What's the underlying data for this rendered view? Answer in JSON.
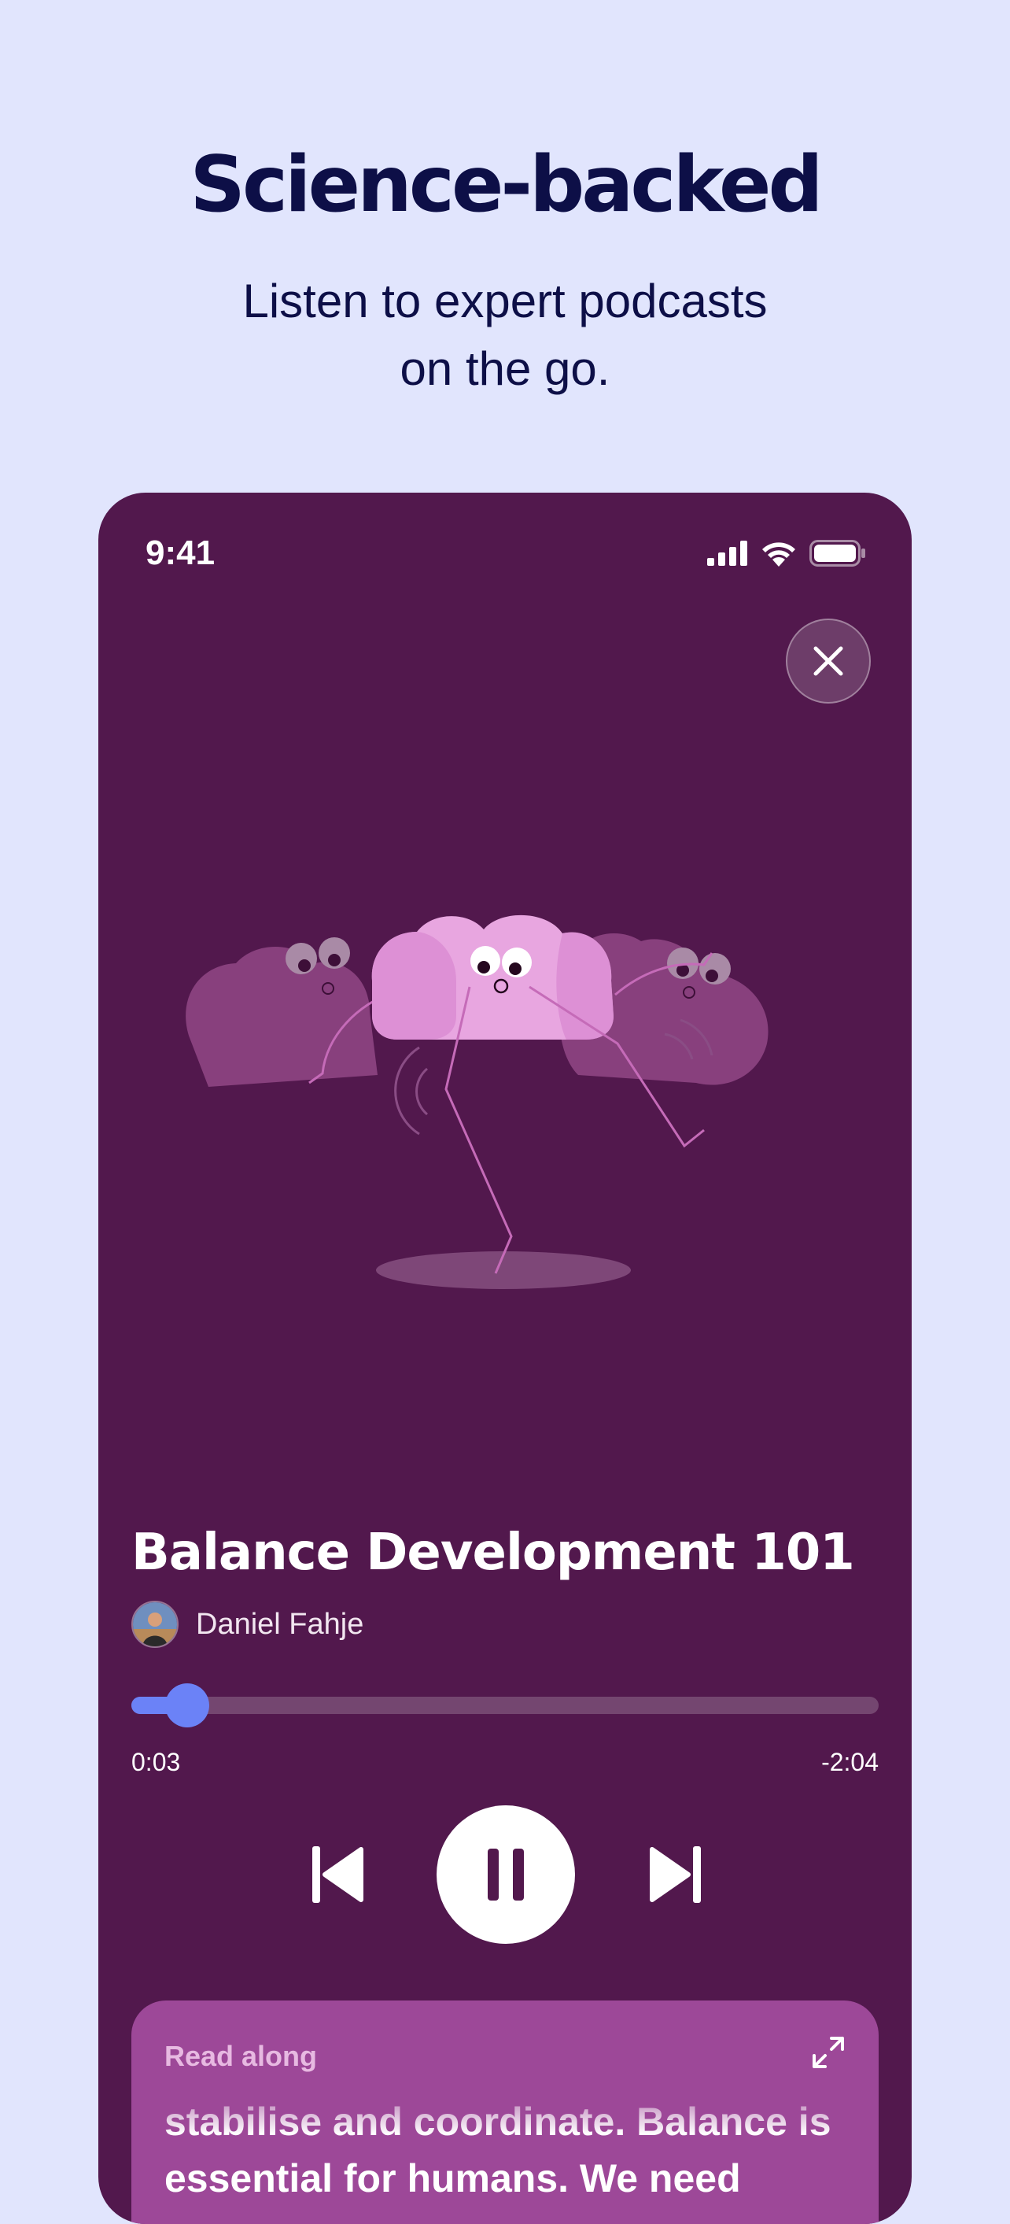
{
  "hero": {
    "title": "Science-backed",
    "subtitle": "Listen to expert podcasts\non the go."
  },
  "status_bar": {
    "time": "9:41",
    "icons": [
      "signal-icon",
      "wifi-icon",
      "battery-icon"
    ]
  },
  "player": {
    "close_icon": "close-icon",
    "track_title": "Balance Development 101",
    "author": "Daniel Fahje",
    "elapsed": "0:03",
    "remaining": "-2:04",
    "progress_percent": 7.5,
    "controls": [
      "previous-icon",
      "pause-icon",
      "next-icon"
    ]
  },
  "read_along": {
    "label": "Read along",
    "text": "stabilise and coordinate. Balance is essential for humans. We need",
    "expand_icon": "expand-icon"
  },
  "colors": {
    "background": "#e1e5fd",
    "heading": "#0d0f47",
    "phone": "#52184d",
    "accent": "#6b82f7",
    "card": "#9d4898"
  }
}
